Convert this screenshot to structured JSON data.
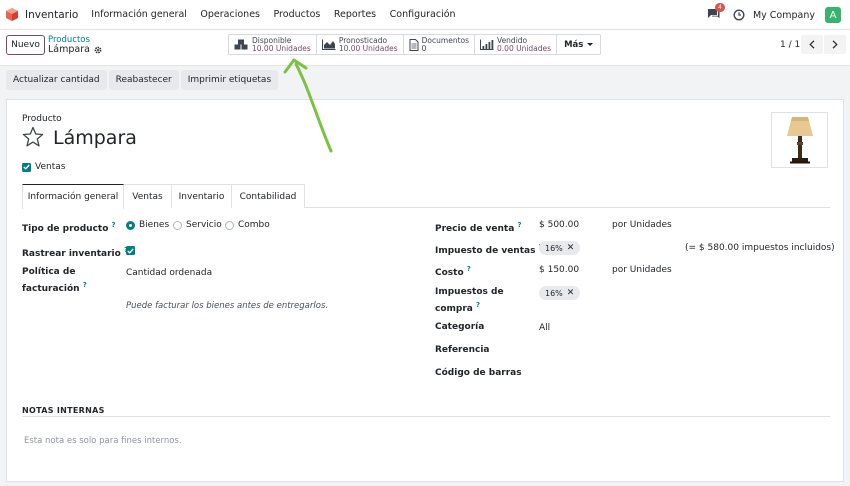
{
  "navbar": {
    "app_name": "Inventario",
    "menu": [
      "Información general",
      "Operaciones",
      "Productos",
      "Reportes",
      "Configuración"
    ],
    "chat_badge": "4",
    "company": "My Company",
    "avatar_letter": "A"
  },
  "controlbar": {
    "new_label": "Nuevo",
    "breadcrumb_parent": "Productos",
    "breadcrumb_current": "Lámpara",
    "stats": [
      {
        "title": "Disponible",
        "value": "10.00 Unidades",
        "icon": "cubes-icon"
      },
      {
        "title": "Pronosticado",
        "value": "10.00 Unidades",
        "icon": "area-chart-icon"
      },
      {
        "title": "Documentos",
        "value": "0",
        "icon": "document-icon"
      },
      {
        "title": "Vendido",
        "value": "0.00 Unidades",
        "icon": "bar-chart-icon"
      }
    ],
    "more_label": "Más",
    "pager": "1 / 1"
  },
  "actions": [
    "Actualizar cantidad",
    "Reabastecer",
    "Imprimir etiquetas"
  ],
  "product": {
    "label": "Producto",
    "name": "Lámpara",
    "sales_checkbox_label": "Ventas"
  },
  "tabs": [
    "Información general",
    "Ventas",
    "Inventario",
    "Contabilidad"
  ],
  "left_fields": {
    "product_type_label": "Tipo de producto",
    "product_type_options": [
      "Bienes",
      "Servicio",
      "Combo"
    ],
    "track_inventory_label": "Rastrear inventario",
    "billing_policy_label_1": "Política de",
    "billing_policy_label_2": "facturación",
    "billing_policy_value": "Cantidad ordenada",
    "billing_hint": "Puede facturar los bienes antes de entregarlos."
  },
  "right_fields": {
    "sale_price_label": "Precio de venta",
    "sale_price_value": "$ 500.00",
    "sale_price_unit": "por Unidades",
    "sales_tax_label": "Impuesto de ventas",
    "sales_tax_tag": "16%",
    "tax_included_note": "(= $ 580.00 impuestos incluidos)",
    "cost_label": "Costo",
    "cost_value": "$ 150.00",
    "cost_unit": "por Unidades",
    "purchase_tax_label_1": "Impuestos de",
    "purchase_tax_label_2": "compra",
    "purchase_tax_tag": "16%",
    "category_label": "Categoría",
    "category_value": "All",
    "reference_label": "Referencia",
    "barcode_label": "Código de barras"
  },
  "notes": {
    "title": "NOTAS INTERNAS",
    "placeholder": "Esta nota es solo para fines internos."
  },
  "help_mark": "?",
  "colors": {
    "primary": "#714b67",
    "accent": "#017e84",
    "annotation_arrow": "#7bc142"
  }
}
